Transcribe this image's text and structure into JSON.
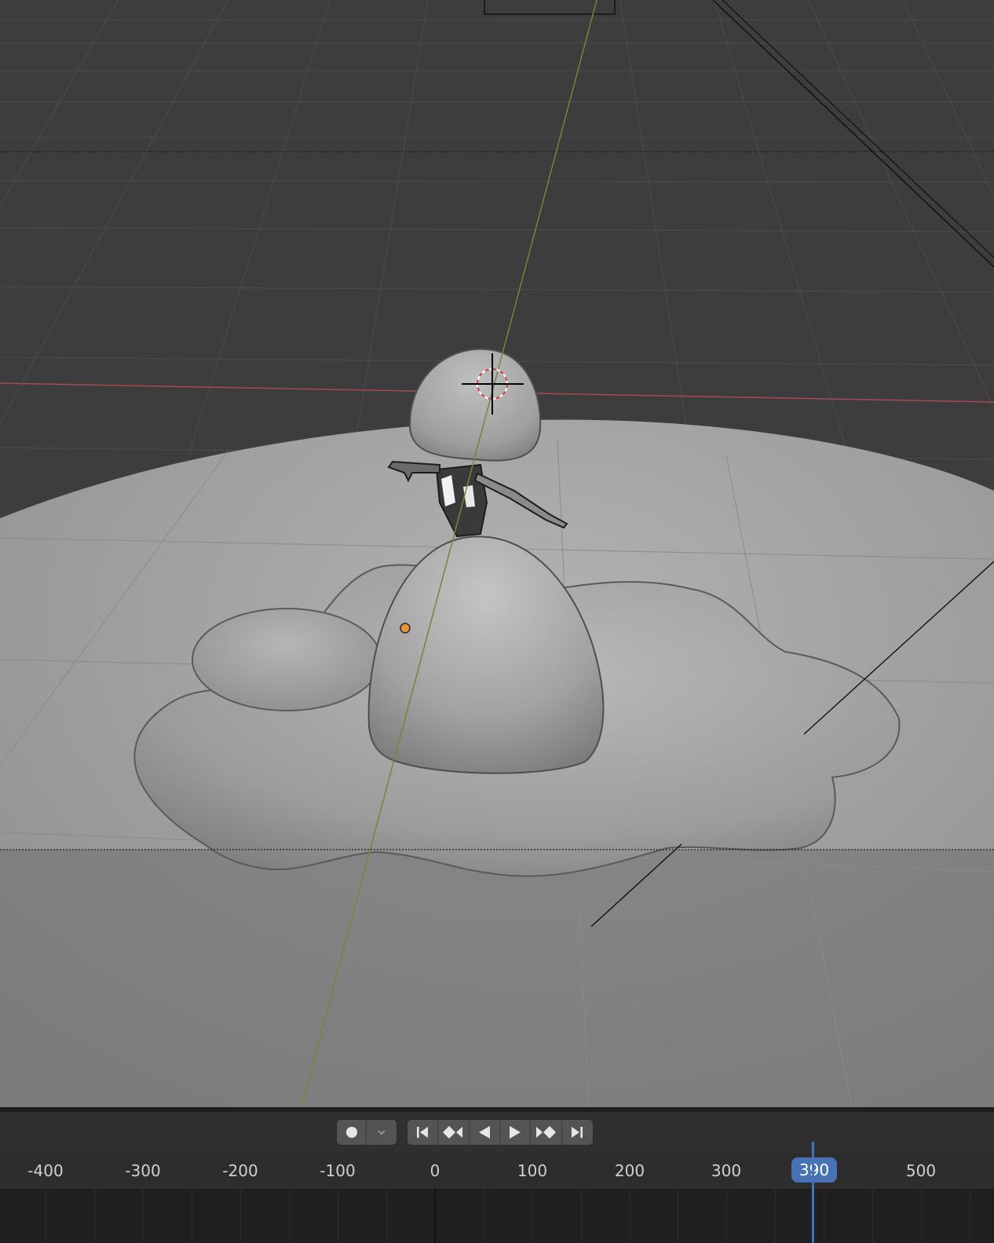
{
  "viewport": {
    "name": "3D Viewport",
    "shading": "solid"
  },
  "timeline": {
    "record_icon": "record-dot-icon",
    "record_menu_icon": "chevron-down-icon",
    "buttons": [
      {
        "name": "jump-to-start-button",
        "icon": "jump-start-icon"
      },
      {
        "name": "jump-to-prev-keyframe-button",
        "icon": "prev-keyframe-icon"
      },
      {
        "name": "play-reverse-button",
        "icon": "play-reverse-icon"
      },
      {
        "name": "play-button",
        "icon": "play-icon"
      },
      {
        "name": "jump-to-next-keyframe-button",
        "icon": "next-keyframe-icon"
      },
      {
        "name": "jump-to-end-button",
        "icon": "jump-end-icon"
      }
    ],
    "ruler_labels": [
      "-400",
      "-300",
      "-200",
      "-100",
      "0",
      "100",
      "200",
      "300",
      "500"
    ],
    "current_frame": "390",
    "accent_color": "#4772b3"
  }
}
